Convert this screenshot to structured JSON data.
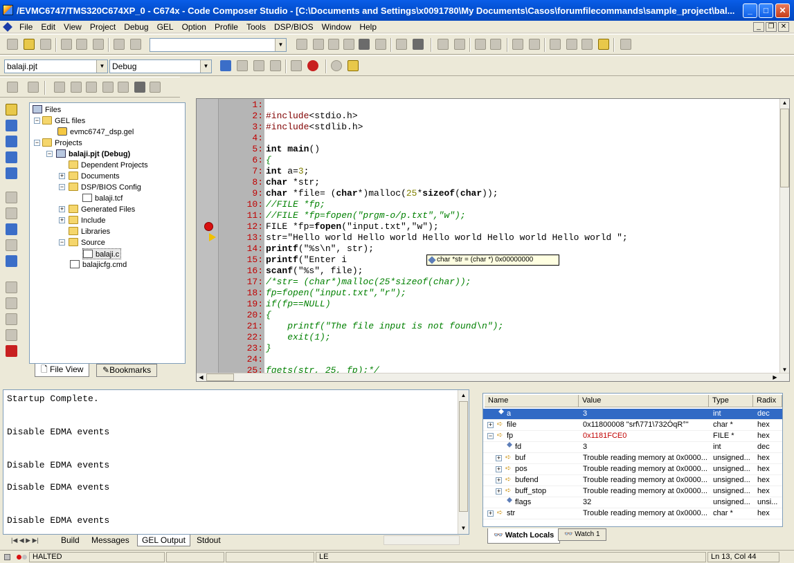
{
  "window": {
    "title": "/EVMC6747/TMS320C674XP_0 - C674x - Code Composer Studio - [C:\\Documents and Settings\\x0091780\\My Documents\\Casos\\forumfilecommands\\sample_project\\bal..."
  },
  "menu": [
    "File",
    "Edit",
    "View",
    "Project",
    "Debug",
    "GEL",
    "Option",
    "Profile",
    "Tools",
    "DSP/BIOS",
    "Window",
    "Help"
  ],
  "toolbar": {
    "project_combo": "balaji.pjt",
    "config_combo": "Debug",
    "search_combo": ""
  },
  "tree": {
    "items": [
      {
        "label": "Files",
        "bold": false
      },
      {
        "label": "GEL files",
        "bold": false
      },
      {
        "label": "evmc6747_dsp.gel",
        "bold": false
      },
      {
        "label": "Projects",
        "bold": false
      },
      {
        "label": "balaji.pjt (Debug)",
        "bold": true
      },
      {
        "label": "Dependent Projects",
        "bold": false
      },
      {
        "label": "Documents",
        "bold": false
      },
      {
        "label": "DSP/BIOS Config",
        "bold": false
      },
      {
        "label": "balaji.tcf",
        "bold": false
      },
      {
        "label": "Generated Files",
        "bold": false
      },
      {
        "label": "Include",
        "bold": false
      },
      {
        "label": "Libraries",
        "bold": false
      },
      {
        "label": "Source",
        "bold": false
      },
      {
        "label": "balaji.c",
        "bold": false
      },
      {
        "label": "balajicfg.cmd",
        "bold": false
      }
    ],
    "tab_fileview": "File View",
    "tab_bookmarks": "Bookmarks"
  },
  "editor": {
    "line_numbers": [
      "1:",
      "2:",
      "3:",
      "4:",
      "5:",
      "6:",
      "7:",
      "8:",
      "9:",
      "10:",
      "11:",
      "12:",
      "13:",
      "14:",
      "15:",
      "16:",
      "17:",
      "18:",
      "19:",
      "20:",
      "21:",
      "22:",
      "23:",
      "24:",
      "25:"
    ],
    "tooltip": "char *str   = (char *) 0x00000000"
  },
  "output": {
    "lines": [
      "Startup Complete.",
      "",
      "Disable EDMA events",
      "",
      "Disable EDMA events",
      "Disable EDMA events",
      "",
      "Disable EDMA events"
    ],
    "tabs": [
      "Build",
      "Messages",
      "GEL Output",
      "Stdout"
    ]
  },
  "watch": {
    "headers": [
      "Name",
      "Value",
      "Type",
      "Radix"
    ],
    "rows": [
      {
        "name": "a",
        "value": "3",
        "type": "int",
        "radix": "dec"
      },
      {
        "name": "file",
        "value": "0x11800008 \"srf\\771\\732ÓqR°\"",
        "type": "char *",
        "radix": "hex"
      },
      {
        "name": "fp",
        "value": "0x1181FCE0",
        "type": "FILE *",
        "radix": "hex"
      },
      {
        "name": "fd",
        "value": "3",
        "type": "int",
        "radix": "dec"
      },
      {
        "name": "buf",
        "value": "Trouble reading memory at 0x0000...",
        "type": "unsigned...",
        "radix": "hex"
      },
      {
        "name": "pos",
        "value": "Trouble reading memory at 0x0000...",
        "type": "unsigned...",
        "radix": "hex"
      },
      {
        "name": "bufend",
        "value": "Trouble reading memory at 0x0000...",
        "type": "unsigned...",
        "radix": "hex"
      },
      {
        "name": "buff_stop",
        "value": "Trouble reading memory at 0x0000...",
        "type": "unsigned...",
        "radix": "hex"
      },
      {
        "name": "flags",
        "value": "32",
        "type": "unsigned...",
        "radix": "unsi..."
      },
      {
        "name": "str",
        "value": "Trouble reading memory at 0x0000...",
        "type": "char *",
        "radix": "hex"
      }
    ],
    "tab_locals": "Watch Locals",
    "tab_watch1": "Watch 1"
  },
  "status": {
    "state": "HALTED",
    "mode": "LE",
    "position": "Ln 13, Col 44"
  }
}
